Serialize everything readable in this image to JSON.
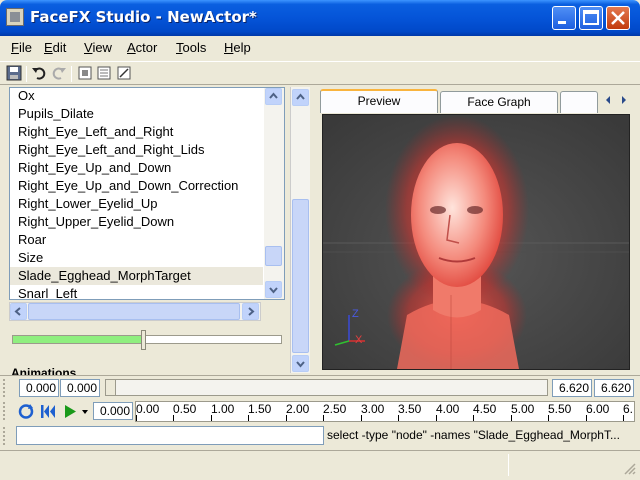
{
  "window": {
    "title": "FaceFX Studio - NewActor*",
    "controls": [
      "minimize-icon",
      "maximize-icon",
      "close-icon"
    ]
  },
  "menu": {
    "items": [
      {
        "key": "F",
        "rest": "ile"
      },
      {
        "key": "E",
        "rest": "dit"
      },
      {
        "key": "V",
        "rest": "iew"
      },
      {
        "key": "A",
        "rest": "ctor"
      },
      {
        "key": "T",
        "rest": "ools"
      },
      {
        "key": "H",
        "rest": "elp"
      }
    ]
  },
  "toolbar": {
    "icons": [
      "save-icon",
      "undo-icon",
      "redo-icon",
      "node-group-icon",
      "list-icon",
      "curve-edit-icon"
    ]
  },
  "nodelist": {
    "items": [
      "Ox",
      "Pupils_Dilate",
      "Right_Eye_Left_and_Right",
      "Right_Eye_Left_and_Right_Lids",
      "Right_Eye_Up_and_Down",
      "Right_Eye_Up_and_Down_Correction",
      "Right_Lower_Eyelid_Up",
      "Right_Upper_Eyelid_Down",
      "Roar",
      "Size",
      "Slade_Egghead_MorphTarget",
      "Snarl_Left"
    ],
    "selected": "Slade_Egghead_MorphTarget"
  },
  "slider": {
    "value_fraction": 0.48
  },
  "animations": {
    "label": "Animations"
  },
  "tabs": [
    {
      "label": "Preview",
      "active": true
    },
    {
      "label": "Face Graph",
      "active": false
    },
    {
      "label": "",
      "active": false
    }
  ],
  "viewport": {
    "axis_labels": {
      "z": "Z",
      "x": "X"
    }
  },
  "timeline": {
    "start_left": "0.000",
    "start_right": "0.000",
    "end_left": "6.620",
    "end_right": "6.620",
    "current_time": "0.000",
    "ruler_ticks": [
      "0.00",
      "0.50",
      "1.00",
      "1.50",
      "2.00",
      "2.50",
      "3.00",
      "3.50",
      "4.00",
      "4.50",
      "5.00",
      "5.50",
      "6.00",
      "6."
    ]
  },
  "command": {
    "input_value": "",
    "output": "select -type \"node\" -names \"Slade_Egghead_MorphT..."
  },
  "colors": {
    "titlebar": "#0554d8",
    "selection": "#ebe8dc",
    "slider_fill": "#8fef7f",
    "tab_highlight": "#f9b43e",
    "viewport_bg": "#454545"
  }
}
